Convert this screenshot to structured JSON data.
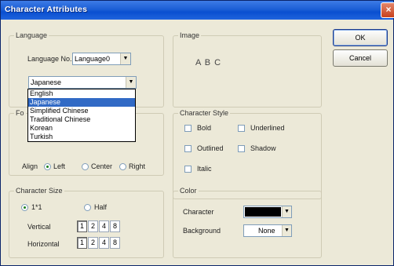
{
  "window": {
    "title": "Character Attributes",
    "close_glyph": "×"
  },
  "buttons": {
    "ok": "OK",
    "cancel": "Cancel"
  },
  "language": {
    "legend": "Language",
    "no_label": "Language No.",
    "no_value": "Language0",
    "selected": "Japanese",
    "options": [
      "English",
      "Japanese",
      "Simplified Chinese",
      "Traditional Chinese",
      "Korean",
      "Turkish"
    ]
  },
  "image": {
    "legend": "Image",
    "preview_text": "A B C"
  },
  "font": {
    "legend_visible": "Fo",
    "align_label": "Align",
    "align_options": [
      "Left",
      "Center",
      "Right"
    ],
    "align_selected": "Left"
  },
  "character_style": {
    "legend": "Character Style",
    "options": [
      "Bold",
      "Underlined",
      "Outlined",
      "Shadow",
      "Italic"
    ]
  },
  "character_size": {
    "legend": "Character Size",
    "options": [
      "1*1",
      "Half"
    ],
    "selected": "1*1",
    "vertical_label": "Vertical",
    "horizontal_label": "Horizontal",
    "multipliers": [
      "1",
      "2",
      "4",
      "8"
    ]
  },
  "color": {
    "legend": "Color",
    "character_label": "Character",
    "character_color": "#000000",
    "background_label": "Background",
    "background_value": "None"
  },
  "arrow_glyph": "▼"
}
